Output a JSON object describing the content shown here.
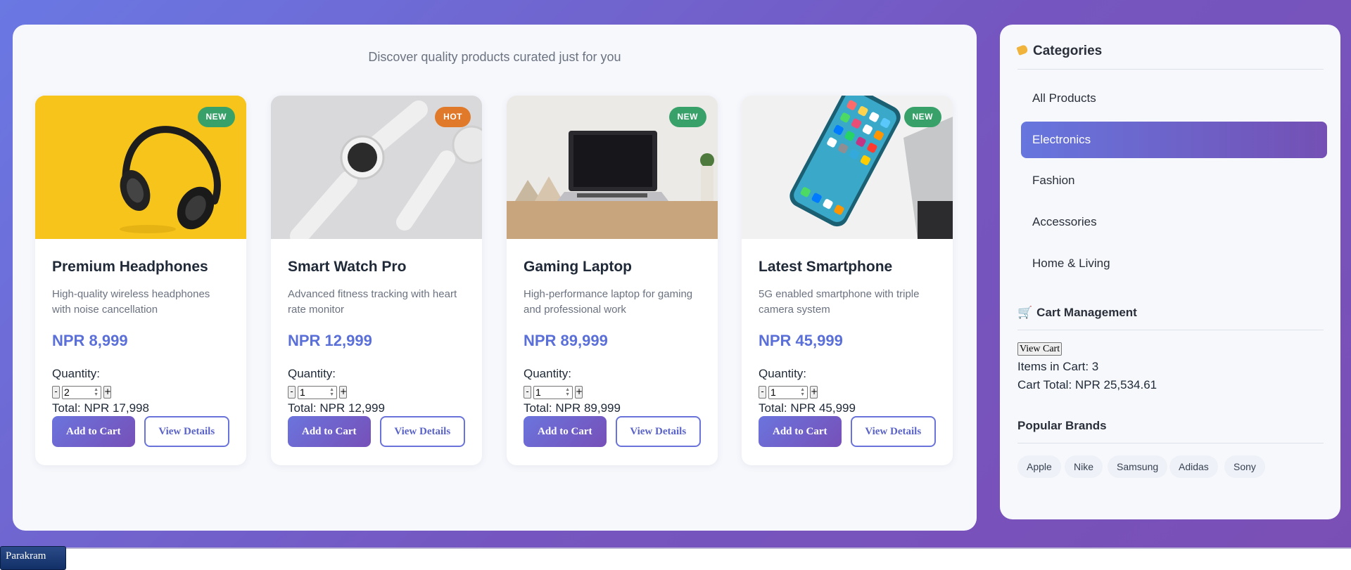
{
  "tagline": "Discover quality products curated just for you",
  "products": [
    {
      "name": "Premium Headphones",
      "description": "High-quality wireless headphones with noise cancellation",
      "price": "NPR 8,999",
      "badge": "NEW",
      "quantity_label": "Quantity:",
      "quantity": "2",
      "total": "Total: NPR 17,998",
      "add_label": "Add to Cart",
      "details_label": "View Details"
    },
    {
      "name": "Smart Watch Pro",
      "description": "Advanced fitness tracking with heart rate monitor",
      "price": "NPR 12,999",
      "badge": "HOT",
      "quantity_label": "Quantity:",
      "quantity": "1",
      "total": "Total: NPR 12,999",
      "add_label": "Add to Cart",
      "details_label": "View Details"
    },
    {
      "name": "Gaming Laptop",
      "description": "High-performance laptop for gaming and professional work",
      "price": "NPR 89,999",
      "badge": "NEW",
      "quantity_label": "Quantity:",
      "quantity": "1",
      "total": "Total: NPR 89,999",
      "add_label": "Add to Cart",
      "details_label": "View Details"
    },
    {
      "name": "Latest Smartphone",
      "description": "5G enabled smartphone with triple camera system",
      "price": "NPR 45,999",
      "badge": "NEW",
      "quantity_label": "Quantity:",
      "quantity": "1",
      "total": "Total: NPR 45,999",
      "add_label": "Add to Cart",
      "details_label": "View Details"
    }
  ],
  "qty_minus": "-",
  "qty_plus": "+",
  "sidebar": {
    "categories_title": "Categories",
    "categories": [
      "All Products",
      "Electronics",
      "Fashion",
      "Accessories",
      "Home & Living"
    ],
    "active_category": "Electronics",
    "cart_title": "Cart Management",
    "view_cart_label": "View Cart",
    "items_in_cart": "Items in Cart: 3",
    "cart_total": "Cart Total: NPR 25,534.61",
    "brands_title": "Popular Brands",
    "brands": [
      "Apple",
      "Nike",
      "Samsung",
      "Adidas",
      "Sony"
    ]
  },
  "taskbar": {
    "label": "Parakram"
  },
  "colors": {
    "accent": "#667eea",
    "accent_dark": "#764ba2",
    "badge_new": "#38a169",
    "badge_hot": "#e07a2a"
  }
}
